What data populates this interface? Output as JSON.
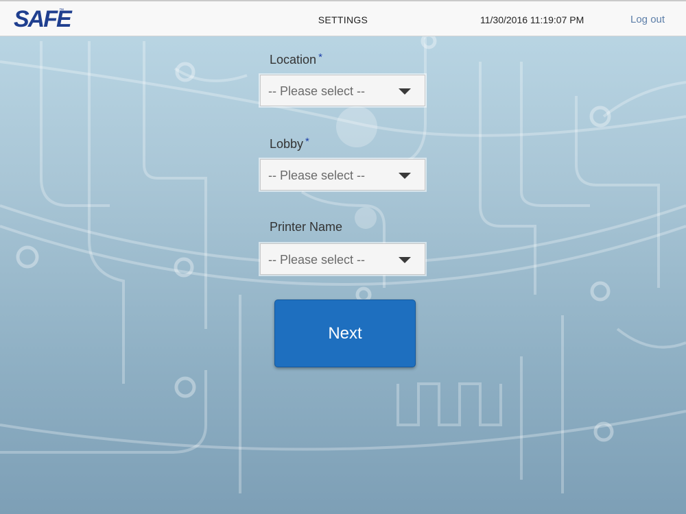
{
  "header": {
    "logo_text": "SAFE",
    "logo_tm": "™",
    "title": "SETTINGS",
    "datetime": "11/30/2016 11:19:07 PM",
    "logout_label": "Log out"
  },
  "form": {
    "required_marker": "*",
    "location": {
      "label": "Location",
      "required": true,
      "value": "-- Please select --"
    },
    "lobby": {
      "label": "Lobby",
      "required": true,
      "value": "-- Please select --"
    },
    "printer": {
      "label": "Printer Name",
      "required": false,
      "value": "-- Please select --"
    },
    "next_label": "Next"
  },
  "icons": {
    "dropdown": "chevron-down-icon"
  },
  "colors": {
    "brand": "#1f3f8f",
    "primary_button": "#1e6fbf",
    "link": "#5c7ea8",
    "required": "#1c3fa8"
  }
}
